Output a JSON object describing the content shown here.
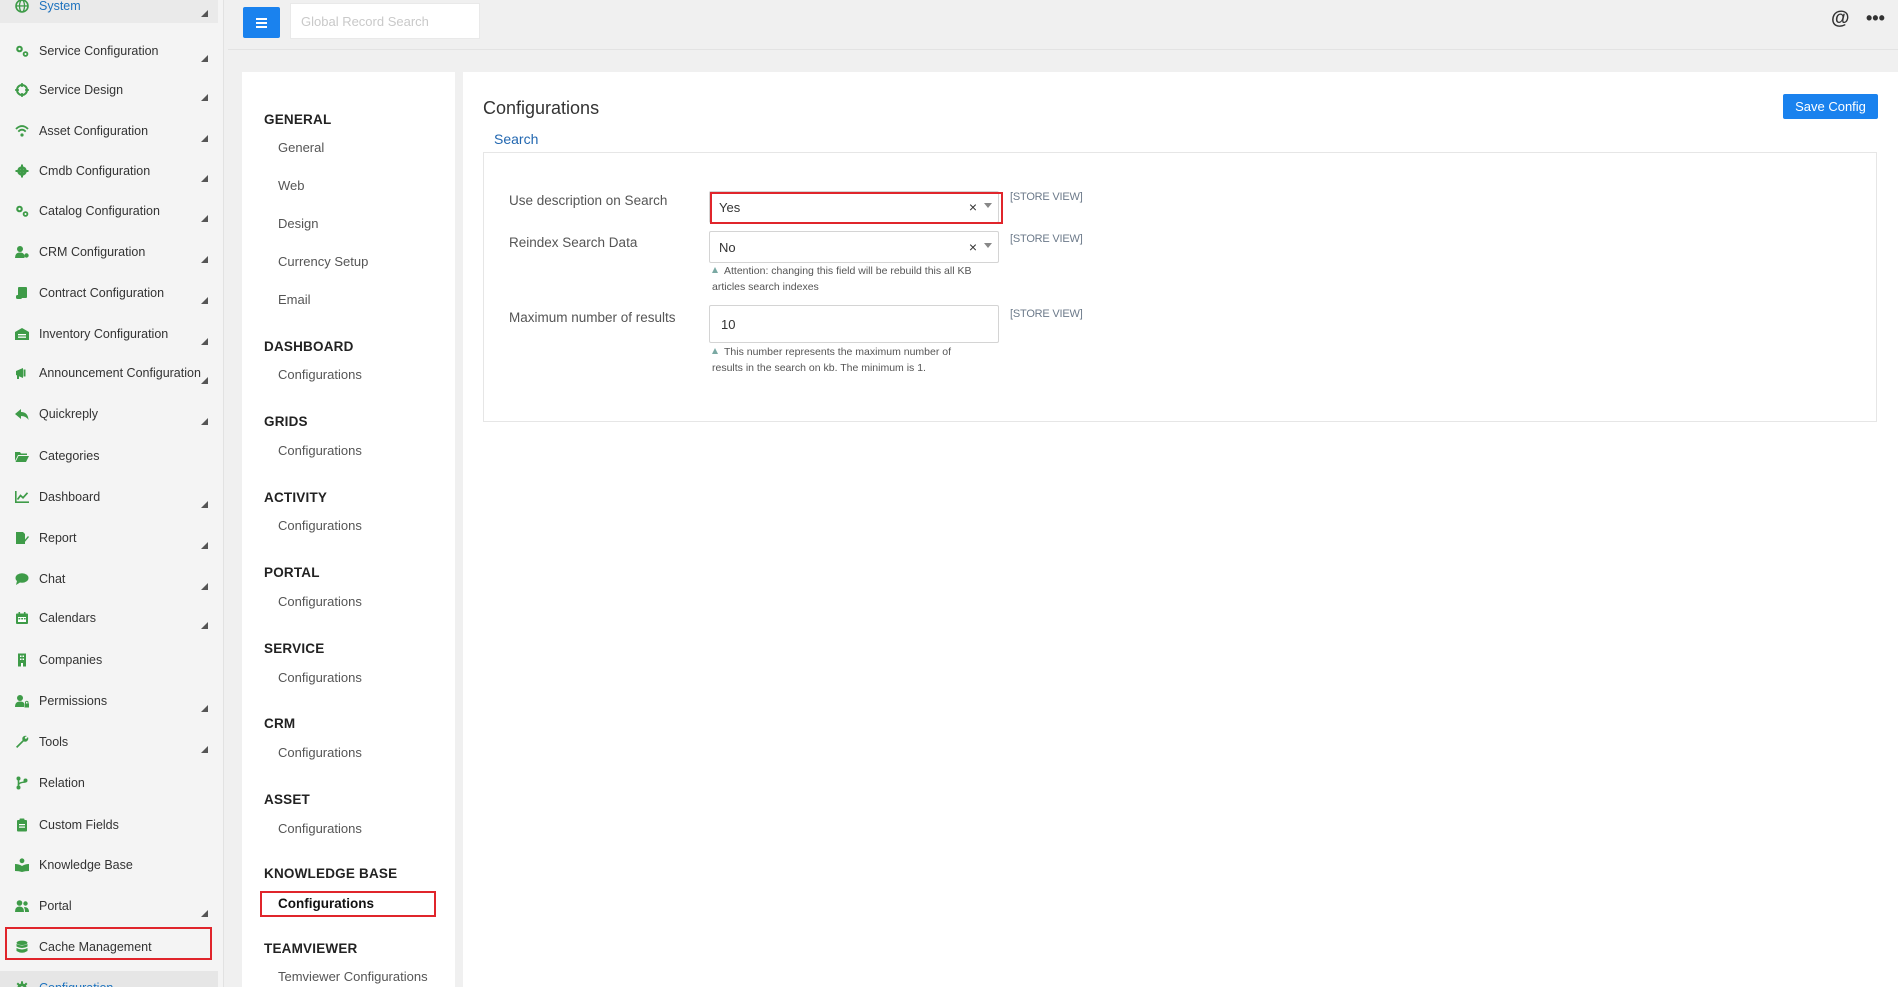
{
  "sidebar": {
    "items": [
      {
        "label": "System",
        "icon": "globe-icon",
        "has_caret": true
      },
      {
        "label": "Service Configuration",
        "icon": "gears-icon",
        "has_caret": true
      },
      {
        "label": "Service Design",
        "icon": "crosshair-icon",
        "has_caret": true
      },
      {
        "label": "Asset Configuration",
        "icon": "wifi-icon",
        "has_caret": true
      },
      {
        "label": "Cmdb Configuration",
        "icon": "gear-icon",
        "has_caret": true
      },
      {
        "label": "Catalog Configuration",
        "icon": "gears-icon",
        "has_caret": true
      },
      {
        "label": "CRM Configuration",
        "icon": "user-gear-icon",
        "has_caret": true
      },
      {
        "label": "Contract Configuration",
        "icon": "scroll-icon",
        "has_caret": true
      },
      {
        "label": "Inventory Configuration",
        "icon": "warehouse-icon",
        "has_caret": true
      },
      {
        "label": "Announcement Configuration",
        "icon": "megaphone-icon",
        "has_caret": true
      },
      {
        "label": "Quickreply",
        "icon": "reply-icon",
        "has_caret": true
      },
      {
        "label": "Categories",
        "icon": "folder-open-icon",
        "has_caret": false
      },
      {
        "label": "Dashboard",
        "icon": "chart-line-icon",
        "has_caret": true
      },
      {
        "label": "Report",
        "icon": "file-edit-icon",
        "has_caret": true
      },
      {
        "label": "Chat",
        "icon": "comment-icon",
        "has_caret": true
      },
      {
        "label": "Calendars",
        "icon": "calendar-icon",
        "has_caret": true
      },
      {
        "label": "Companies",
        "icon": "building-icon",
        "has_caret": false
      },
      {
        "label": "Permissions",
        "icon": "user-lock-icon",
        "has_caret": true
      },
      {
        "label": "Tools",
        "icon": "wrench-icon",
        "has_caret": true
      },
      {
        "label": "Relation",
        "icon": "branch-icon",
        "has_caret": false
      },
      {
        "label": "Custom Fields",
        "icon": "clipboard-icon",
        "has_caret": false
      },
      {
        "label": "Knowledge Base",
        "icon": "book-reader-icon",
        "has_caret": false
      },
      {
        "label": "Portal",
        "icon": "users-icon",
        "has_caret": true
      },
      {
        "label": "Cache Management",
        "icon": "database-icon",
        "has_caret": false
      },
      {
        "label": "Configuration",
        "icon": "cog-icon",
        "has_caret": false
      }
    ],
    "active_item": "Configuration"
  },
  "topbar": {
    "search_placeholder": "Global Record Search",
    "at_symbol": "@",
    "more_symbol": "•••"
  },
  "config_nav": {
    "sections": [
      {
        "title": "GENERAL",
        "links": [
          "General",
          "Web",
          "Design",
          "Currency Setup",
          "Email"
        ]
      },
      {
        "title": "DASHBOARD",
        "links": [
          "Configurations"
        ]
      },
      {
        "title": "GRIDS",
        "links": [
          "Configurations"
        ]
      },
      {
        "title": "ACTIVITY",
        "links": [
          "Configurations"
        ]
      },
      {
        "title": "PORTAL",
        "links": [
          "Configurations"
        ]
      },
      {
        "title": "SERVICE",
        "links": [
          "Configurations"
        ]
      },
      {
        "title": "CRM",
        "links": [
          "Configurations"
        ]
      },
      {
        "title": "ASSET",
        "links": [
          "Configurations"
        ]
      },
      {
        "title": "KNOWLEDGE BASE",
        "links": [
          "Configurations"
        ]
      },
      {
        "title": "TEAMVIEWER",
        "links": [
          "Temviewer Configurations"
        ]
      }
    ],
    "current": "KNOWLEDGE BASE / Configurations"
  },
  "main": {
    "title": "Configurations",
    "save_label": "Save Config",
    "group_tab": "Search",
    "fields": [
      {
        "label": "Use description on Search",
        "type": "select",
        "value": "Yes",
        "scope": "[STORE VIEW]",
        "note": ""
      },
      {
        "label": "Reindex Search Data",
        "type": "select",
        "value": "No",
        "scope": "[STORE VIEW]",
        "note": "Attention: changing this field will be rebuild this all KB articles search indexes"
      },
      {
        "label": "Maximum number of results",
        "type": "text",
        "value": "10",
        "scope": "[STORE VIEW]",
        "note": "This number represents the maximum number of results in the search on kb. The minimum is 1."
      }
    ],
    "clear_symbol": "×"
  },
  "colors": {
    "accent": "#1a82ee",
    "icon_green": "#3e9b48",
    "highlight_red": "#e0252b",
    "link_blue": "#2267b0"
  }
}
